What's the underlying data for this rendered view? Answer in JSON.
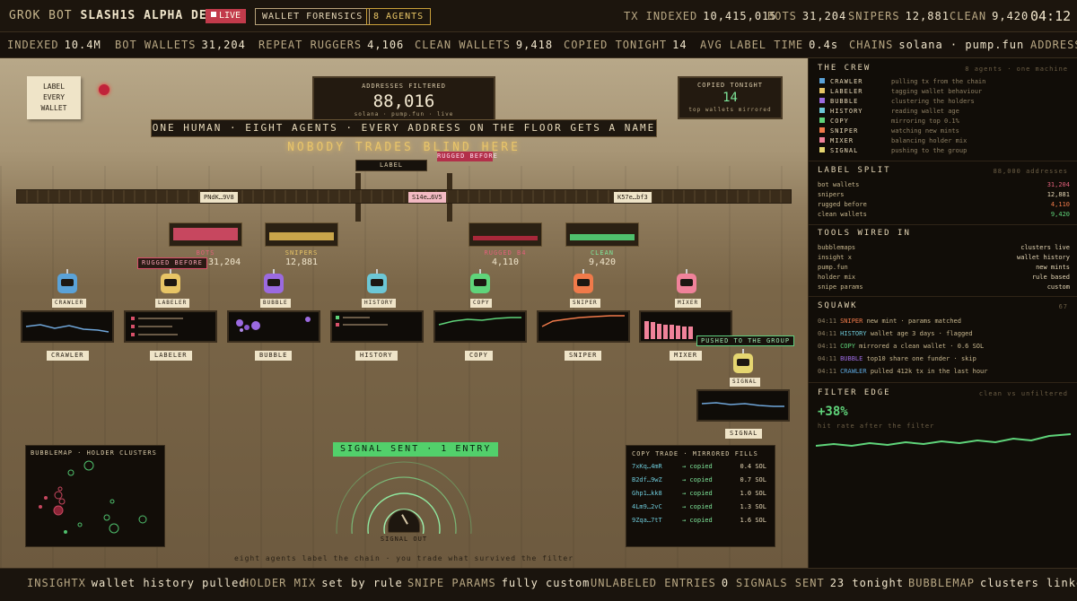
{
  "header": {
    "app_name": "GROK BOT",
    "desk_name": "SLASH1S ALPHA DESK",
    "live_label": "LIVE",
    "tag_forensics": "WALLET FORENSICS",
    "tag_agents": "8 AGENTS",
    "stats": [
      {
        "label": "TX INDEXED",
        "value": "10,415,015"
      },
      {
        "label": "BOTS",
        "value": "31,204"
      },
      {
        "label": "SNIPERS",
        "value": "12,881"
      },
      {
        "label": "CLEAN",
        "value": "9,420"
      }
    ],
    "clock": "04:12"
  },
  "ticker": [
    {
      "label": "INDEXED",
      "value": "10.4M"
    },
    {
      "label": "BOT WALLETS",
      "value": "31,204"
    },
    {
      "label": "REPEAT RUGGERS",
      "value": "4,106"
    },
    {
      "label": "CLEAN WALLETS",
      "value": "9,418"
    },
    {
      "label": "COPIED TONIGHT",
      "value": "14"
    },
    {
      "label": "AVG LABEL TIME",
      "value": "0.4s"
    },
    {
      "label": "CHAINS",
      "value": "solana · pump.fun"
    },
    {
      "label": "ADDRESS",
      "value": ""
    }
  ],
  "floor": {
    "note": [
      "LABEL",
      "EVERY",
      "WALLET"
    ],
    "filtered": {
      "label": "ADDRESSES FILTERED",
      "value": "88,016",
      "sub": "solana · pump.fun · live"
    },
    "copied": {
      "label": "COPIED TONIGHT",
      "value": "14",
      "sub": "top wallets mirrored"
    },
    "banner": "ONE HUMAN · EIGHT AGENTS · EVERY ADDRESS ON THE FLOOR GETS A NAME",
    "glow": "NOBODY TRADES BLIND HERE",
    "label_tag": "LABEL",
    "rugged_tag": "RUGGED BEFORE",
    "packages": [
      "PNdK…9V8",
      "S14e…6V5",
      "K57e…bf3"
    ],
    "bins": [
      {
        "label": "BOTS",
        "value": "31,204",
        "color": "#c7475f"
      },
      {
        "label": "SNIPERS",
        "value": "12,881",
        "color": "#c9a54a"
      },
      {
        "label": "RUGGED B4",
        "value": "4,110",
        "color": "#a8283a"
      },
      {
        "label": "CLEAN",
        "value": "9,420",
        "color": "#4fc06d"
      }
    ],
    "rugged_annotation": "RUGGED BEFORE",
    "agents": [
      {
        "name": "CRAWLER",
        "color": "#5aa2d8"
      },
      {
        "name": "LABELER",
        "color": "#e8c565"
      },
      {
        "name": "BUBBLE",
        "color": "#9b6ae0"
      },
      {
        "name": "HISTORY",
        "color": "#6cc7d6"
      },
      {
        "name": "COPY",
        "color": "#5fd47a"
      },
      {
        "name": "SNIPER",
        "color": "#f07a4a"
      },
      {
        "name": "MIXER",
        "color": "#f0829a"
      },
      {
        "name": "SIGNAL",
        "color": "#e6d670"
      }
    ],
    "pushed": "PUSHED TO THE GROUP",
    "signal_sent": "SIGNAL SENT · 1 ENTRY",
    "signal_out": "SIGNAL OUT",
    "bubblemap_title": "BUBBLEMAP · HOLDER CLUSTERS",
    "copy_trade": {
      "title": "COPY TRADE · MIRRORED FILLS",
      "rows": [
        {
          "wallet": "7xKq…4mR",
          "status": "→ copied",
          "amount": "0.4 SOL"
        },
        {
          "wallet": "B2df…9wZ",
          "status": "→ copied",
          "amount": "0.7 SOL"
        },
        {
          "wallet": "Ghp1…kk8",
          "status": "→ copied",
          "amount": "1.0 SOL"
        },
        {
          "wallet": "4Lm9…2vC",
          "status": "→ copied",
          "amount": "1.3 SOL"
        },
        {
          "wallet": "9Zqa…7tT",
          "status": "→ copied",
          "amount": "1.6 SOL"
        }
      ]
    },
    "footnote": "eight agents label the chain · you trade what survived the filter"
  },
  "side": {
    "crew_title": "THE CREW",
    "crew_sub": "8 agents · one machine",
    "crew": [
      {
        "name": "CRAWLER",
        "desc": "pulling tx from the chain",
        "color": "#5aa2d8"
      },
      {
        "name": "LABELER",
        "desc": "tagging wallet behaviour",
        "color": "#e8c565"
      },
      {
        "name": "BUBBLE",
        "desc": "clustering the holders",
        "color": "#9b6ae0"
      },
      {
        "name": "HISTORY",
        "desc": "reading wallet age",
        "color": "#6cc7d6"
      },
      {
        "name": "COPY",
        "desc": "mirroring top 0.1%",
        "color": "#5fd47a"
      },
      {
        "name": "SNIPER",
        "desc": "watching new mints",
        "color": "#f07a4a"
      },
      {
        "name": "MIXER",
        "desc": "balancing holder mix",
        "color": "#f0829a"
      },
      {
        "name": "SIGNAL",
        "desc": "pushing to the group",
        "color": "#e6d670"
      }
    ],
    "split_title": "LABEL SPLIT",
    "split_sub": "88,000 addresses",
    "split": [
      {
        "k": "bot wallets",
        "v": "31,204",
        "color": "#e0607a"
      },
      {
        "k": "snipers",
        "v": "12,881",
        "color": "#e6d7b6"
      },
      {
        "k": "rugged before",
        "v": "4,110",
        "color": "#f07a4a"
      },
      {
        "k": "clean wallets",
        "v": "9,420",
        "color": "#5fd47a"
      }
    ],
    "tools_title": "TOOLS WIRED IN",
    "tools": [
      {
        "k": "bubblemaps",
        "v": "clusters live"
      },
      {
        "k": "insight x",
        "v": "wallet history"
      },
      {
        "k": "pump.fun",
        "v": "new mints"
      },
      {
        "k": "holder mix",
        "v": "rule based"
      },
      {
        "k": "snipe params",
        "v": "custom"
      }
    ],
    "squawk_title": "SQUAWK",
    "squawk_count": "67",
    "squawk": [
      {
        "t": "04:11",
        "who": "SNIPER",
        "msg": "new mint · params matched",
        "color": "#f07a4a"
      },
      {
        "t": "04:11",
        "who": "HISTORY",
        "msg": "wallet age 3 days · flagged",
        "color": "#6cc7d6"
      },
      {
        "t": "04:11",
        "who": "COPY",
        "msg": "mirrored a clean wallet · 0.6 SOL",
        "color": "#5fd47a"
      },
      {
        "t": "04:11",
        "who": "BUBBLE",
        "msg": "top10 share one funder · skip",
        "color": "#9b6ae0"
      },
      {
        "t": "04:11",
        "who": "CRAWLER",
        "msg": "pulled 412k tx in the last hour",
        "color": "#5aa2d8"
      }
    ],
    "edge_title": "FILTER EDGE",
    "edge_sub": "clean vs unfiltered",
    "edge_value": "+38%",
    "edge_caption": "hit rate after the filter"
  },
  "bottom": [
    {
      "label": "INSIGHTX",
      "value": "wallet history pulled"
    },
    {
      "label": "HOLDER MIX",
      "value": "set by rule"
    },
    {
      "label": "SNIPE PARAMS",
      "value": "fully custom"
    },
    {
      "label": "UNLABELED ENTRIES",
      "value": "0"
    },
    {
      "label": "SIGNALS SENT",
      "value": "23 tonight"
    },
    {
      "label": "BUBBLEMAP",
      "value": "clusters linked"
    }
  ]
}
